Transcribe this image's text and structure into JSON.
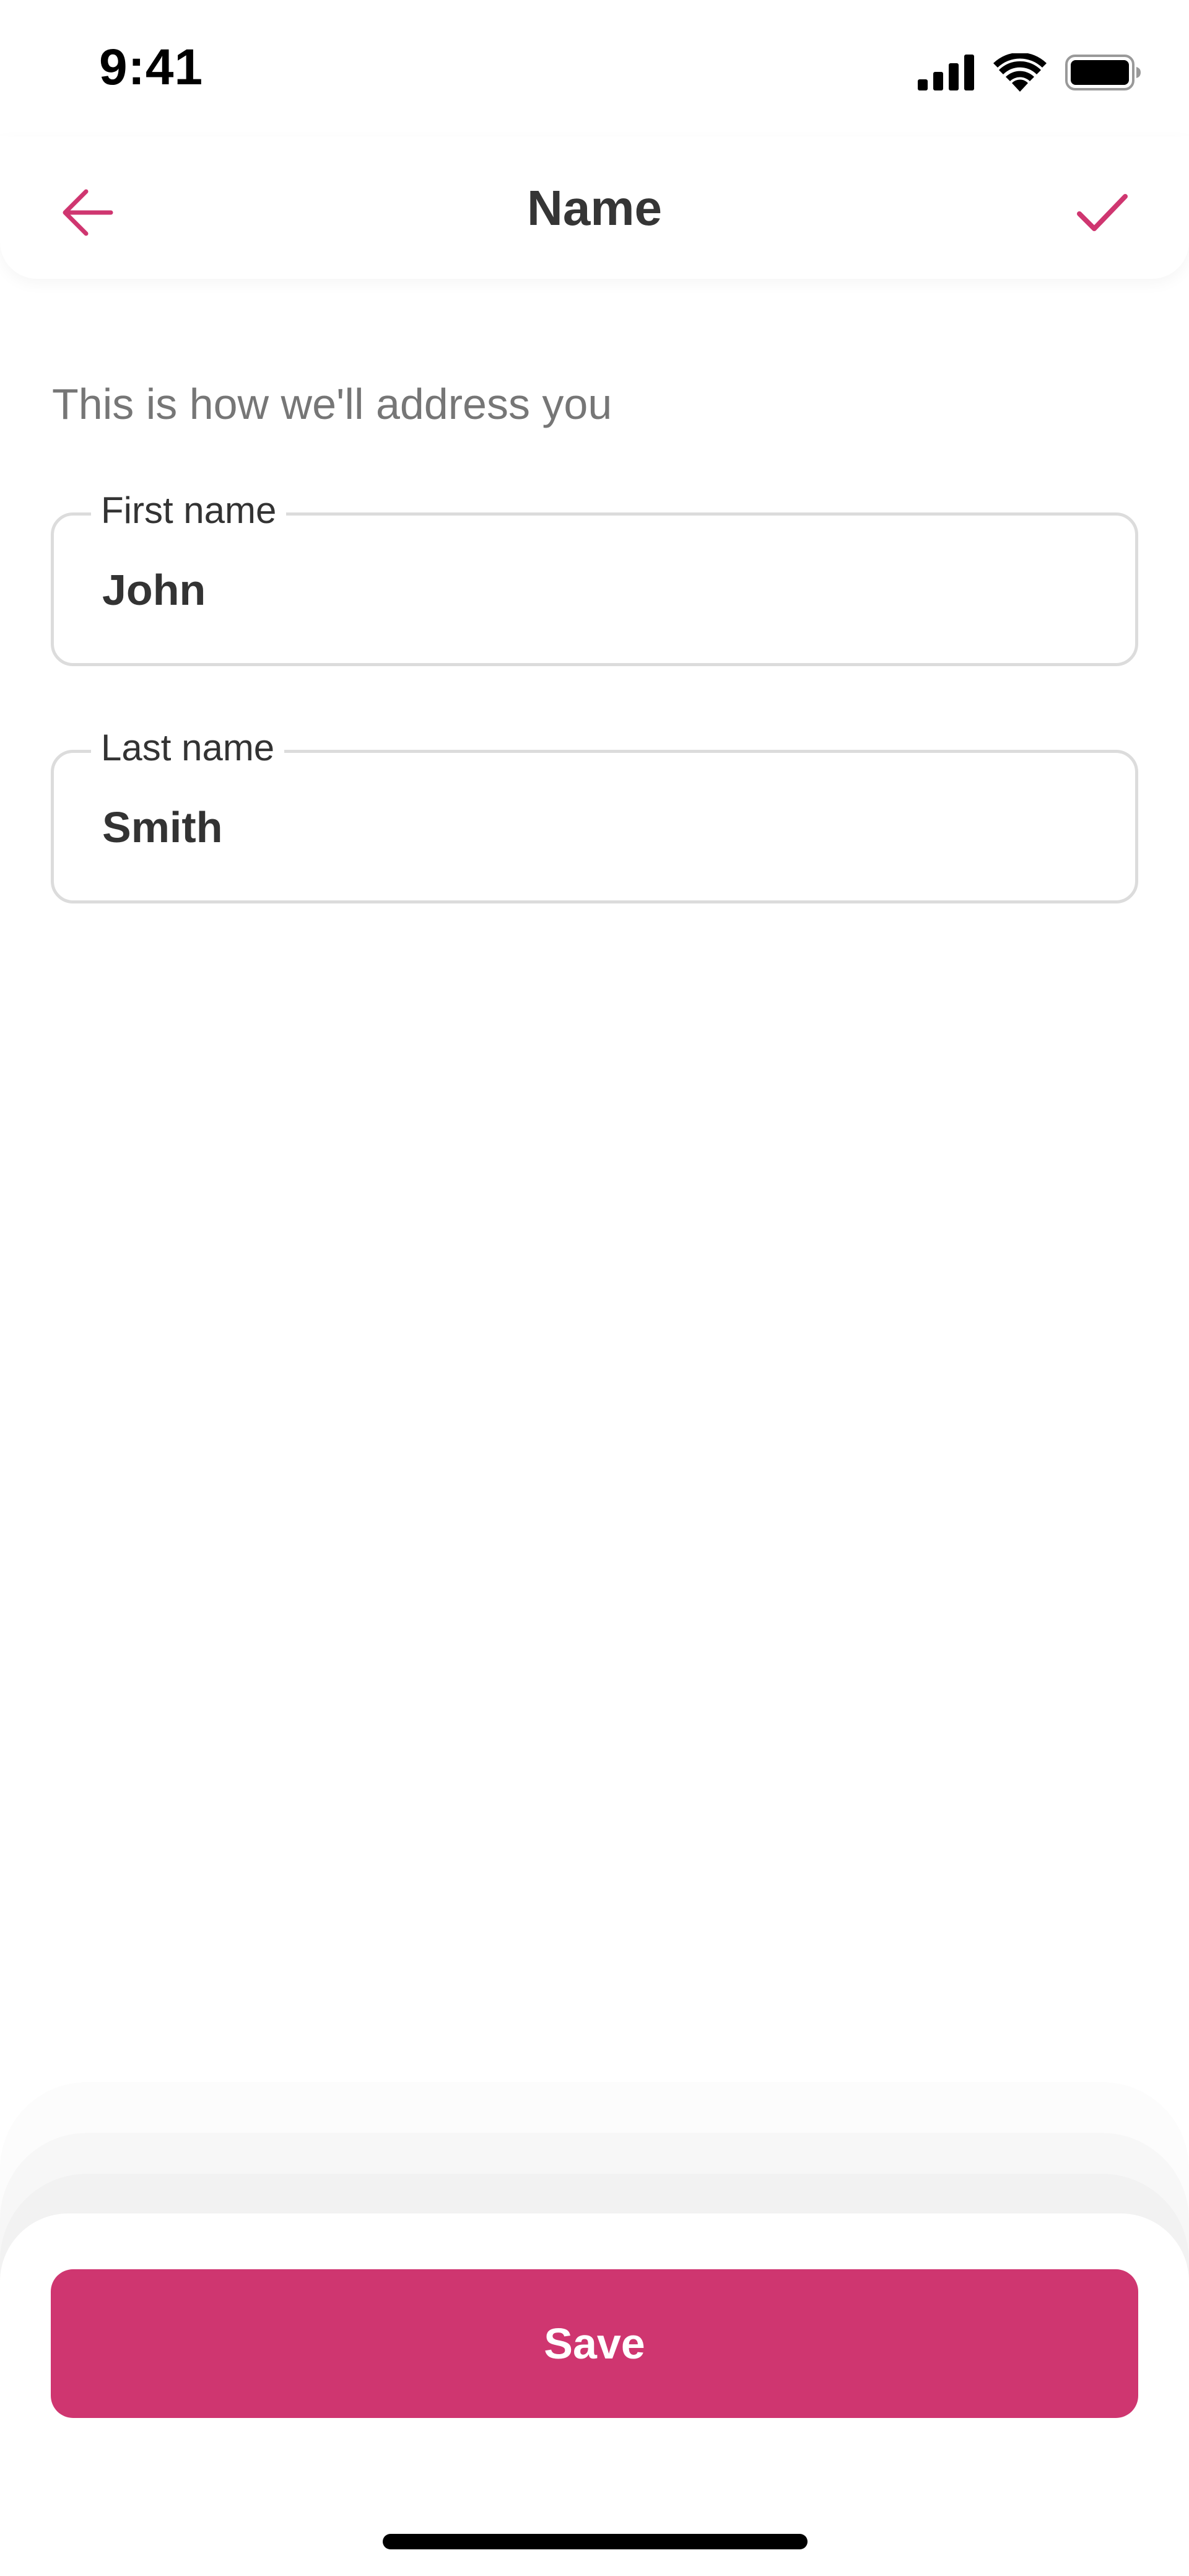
{
  "status_bar": {
    "time": "9:41",
    "icons": [
      "cellular-signal-icon",
      "wifi-icon",
      "battery-icon"
    ]
  },
  "header": {
    "title": "Name",
    "back_icon": "arrow-left-icon",
    "confirm_icon": "checkmark-icon"
  },
  "content": {
    "subtitle": "This is how we'll address you",
    "fields": {
      "first_name": {
        "label": "First name",
        "value": "John"
      },
      "last_name": {
        "label": "Last name",
        "value": "Smith"
      }
    }
  },
  "footer": {
    "save_label": "Save"
  },
  "colors": {
    "accent": "#cf3670",
    "text": "#333333",
    "subtitle": "#767676",
    "border": "#dcdcdc"
  }
}
